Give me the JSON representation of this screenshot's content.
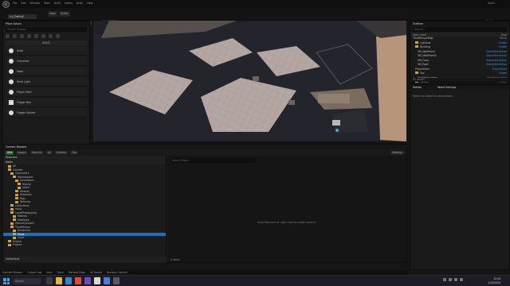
{
  "window": {
    "title": "Kotlin",
    "menu": [
      "File",
      "Edit",
      "Window",
      "Tools",
      "Build",
      "Select",
      "Actor",
      "Help"
    ],
    "level_tab": "Lvl_Default"
  },
  "toolbar": {
    "buttons": [
      "Save",
      "Select",
      "Platforms"
    ],
    "settings": "Settings"
  },
  "place_actors": {
    "title": "Place Actors",
    "search_placeholder": "Search Classes",
    "section": "BASIC",
    "items": [
      "Actor",
      "Character",
      "Pawn",
      "Point Light",
      "Player Start",
      "Trigger Box",
      "Trigger Sphere"
    ]
  },
  "outliner": {
    "tab": "Outliner",
    "search_placeholder": "Search...",
    "col_label": "Item Label",
    "col_type": "Type",
    "rows": [
      {
        "name": "ThirdPersonMap",
        "type": "World"
      },
      {
        "name": "Lighting",
        "type": "Folder"
      },
      {
        "name": "Building",
        "type": "Folder"
      },
      {
        "name": "SM_WallPanel",
        "type": "StaticMeshActor"
      },
      {
        "name": "SM_WallPanel2",
        "type": "StaticMeshActor"
      },
      {
        "name": "SM_Floor",
        "type": "StaticMeshActor"
      },
      {
        "name": "SM_Roof",
        "type": "StaticMeshActor"
      },
      {
        "name": "PlayerStart",
        "type": "PlayerStart"
      },
      {
        "name": "Sky",
        "type": "Folder"
      },
      {
        "name": "SkyAtmosphere",
        "type": "SkyAtmosphere"
      },
      {
        "name": "Terrain",
        "type": "Folder"
      },
      {
        "name": "Landscape",
        "type": "Landscape"
      }
    ],
    "footer": "62 actors"
  },
  "details": {
    "tab": "Details",
    "world_settings": "World Settings",
    "empty_text": "Select an object to view details."
  },
  "content_browser": {
    "title": "Content Browser",
    "toolbar": [
      "Add",
      "Import",
      "Save All",
      "All",
      "Content",
      "Fab"
    ],
    "settings": "Settings",
    "favorites": "Favorites",
    "tree_root": "Kotlin",
    "tree": [
      "All",
      "Content",
      "Characters",
      "Mannequins",
      "Animations",
      "Manny",
      "Quinn",
      "Meshes",
      "Materials",
      "Rigs",
      "Textures",
      "Collections",
      "Input",
      "LevelPrototyping",
      "Meshes",
      "Materials",
      "StarterContent",
      "ThirdPerson",
      "Blueprints",
      "Maps",
      "Input",
      "Engine",
      "Plugins"
    ],
    "selected_index": 19,
    "filter_placeholder": "Search Maps",
    "empty_text": "Drop files here or right click to create content.",
    "item_count": "0 items",
    "collections": "Collections"
  },
  "statusbar": {
    "items": [
      "Content Drawer",
      "Output Log",
      "Cmd",
      "Trace",
      "Derived Data",
      "All Saved",
      "Revision Control"
    ]
  },
  "taskbar": {
    "search": "Search",
    "time": "12:45",
    "date": "1/15/2025"
  }
}
